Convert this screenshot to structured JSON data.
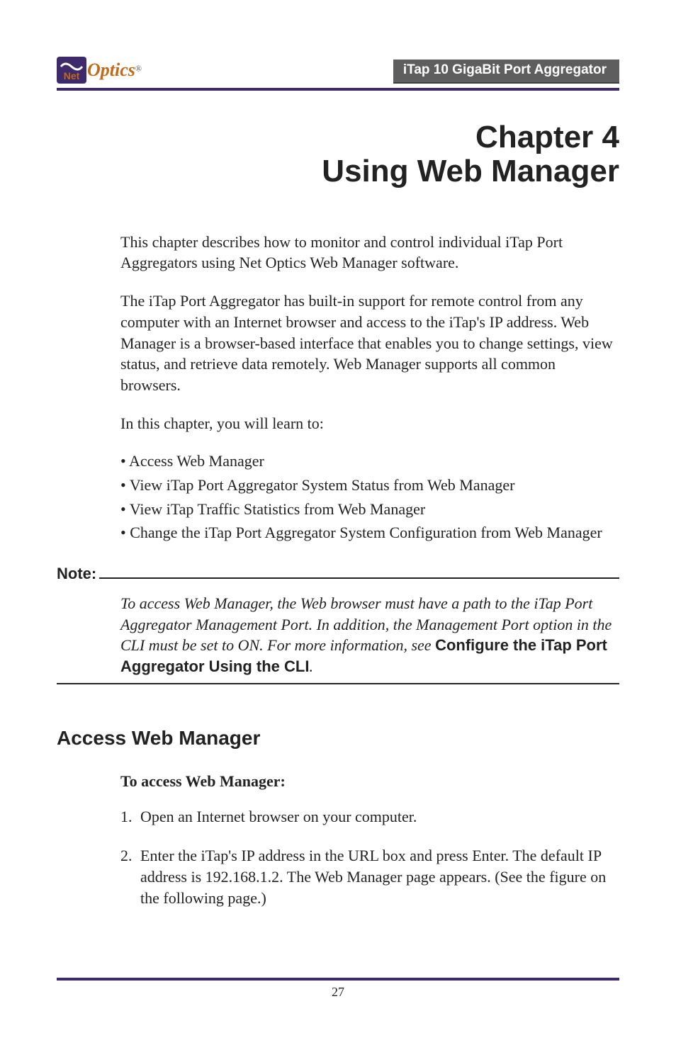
{
  "header": {
    "logo_net": "Net",
    "logo_optics": "Optics",
    "logo_reg": "®",
    "product_title": "iTap 10 GigaBit Port Aggregator"
  },
  "chapter": {
    "label": "Chapter 4",
    "title": "Using Web Manager"
  },
  "intro": {
    "p1": "This chapter describes how to monitor and control individual iTap Port Aggregators using Net Optics Web Manager software.",
    "p2": "The iTap Port Aggregator has built-in support for remote control from any computer with an Internet browser and access to the iTap's IP address. Web Manager is a browser-based interface that enables you to change settings, view status, and retrieve data remotely. Web Manager supports all common browsers.",
    "p3": "In this chapter, you will learn to:"
  },
  "bullets": [
    "Access Web Manager",
    "View iTap Port Aggregator System Status from Web Manager",
    "View iTap Traffic Statistics from Web Manager",
    "Change the iTap Port Aggregator System Configuration from Web Manager"
  ],
  "note": {
    "label": "Note:",
    "body_italic": "To access Web Manager, the Web browser must have a path to the iTap Port Aggregator Management Port. In addition, the Management Port option in the CLI must be set to ON. For more information, see ",
    "body_bold": "Configure the iTap Port Aggregator Using the CLI",
    "body_tail": "."
  },
  "section": {
    "heading": "Access Web Manager",
    "subheading": "To access Web Manager:",
    "steps": [
      {
        "n": "1.",
        "text": "Open an Internet browser on your computer."
      },
      {
        "n": "2.",
        "text": "Enter the iTap's IP address in the URL box and press Enter. The default IP address is  192.168.1.2. The Web Manager page appears. (See the figure on the following page.)"
      }
    ]
  },
  "footer": {
    "page_number": "27"
  }
}
